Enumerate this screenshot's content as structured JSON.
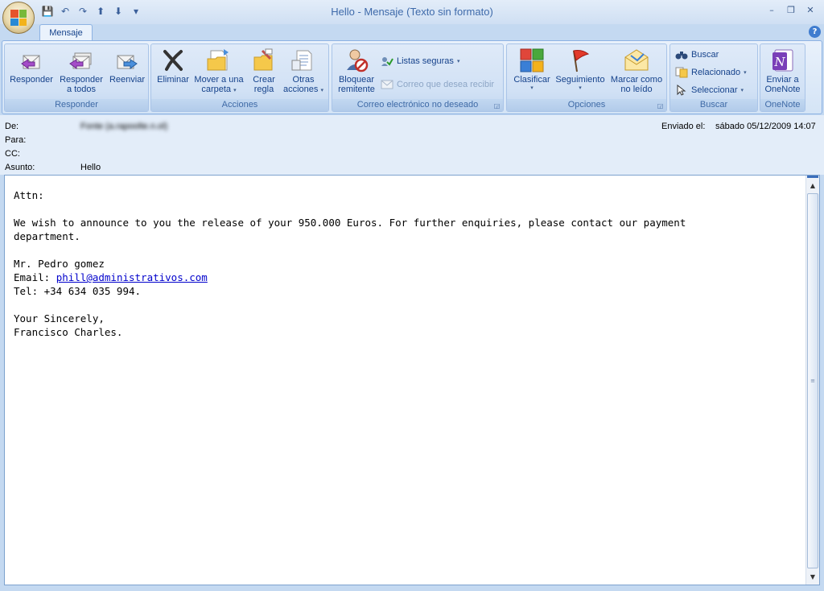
{
  "window": {
    "title": "Hello  -  Mensaje (Texto sin formato)",
    "controls": [
      "–",
      "❐",
      "✕"
    ]
  },
  "qat": [
    "💾",
    "↶",
    "↷",
    "⬆",
    "⬇",
    "▾"
  ],
  "tabs": [
    {
      "label": "Mensaje"
    }
  ],
  "ribbon": {
    "groups": [
      {
        "label": "Responder",
        "buttons": [
          {
            "label": "Responder"
          },
          {
            "label": "Responder\na todos"
          },
          {
            "label": "Reenviar"
          }
        ]
      },
      {
        "label": "Acciones",
        "buttons": [
          {
            "label": "Eliminar"
          },
          {
            "label": "Mover a una\ncarpeta"
          },
          {
            "label": "Crear\nregla"
          },
          {
            "label": "Otras\nacciones"
          }
        ]
      },
      {
        "label": "Correo electrónico no deseado",
        "buttons": [
          {
            "label": "Bloquear\nremitente"
          },
          {
            "label": "Listas seguras"
          },
          {
            "label": "Correo que desea recibir"
          }
        ]
      },
      {
        "label": "Opciones",
        "buttons": [
          {
            "label": "Clasificar"
          },
          {
            "label": "Seguimiento"
          },
          {
            "label": "Marcar como\nno leído"
          }
        ]
      },
      {
        "label": "Buscar",
        "buttons": [
          {
            "label": "Buscar"
          },
          {
            "label": "Relacionado"
          },
          {
            "label": "Seleccionar"
          }
        ]
      },
      {
        "label": "OneNote",
        "buttons": [
          {
            "label": "Enviar a\nOneNote"
          }
        ]
      }
    ]
  },
  "header": {
    "from_label": "De:",
    "from_value": "Fonte (a.rapoolte.n.ol)",
    "to_label": "Para:",
    "cc_label": "CC:",
    "subject_label": "Asunto:",
    "subject_value": "Hello",
    "sent_label": "Enviado el:",
    "sent_value": "sábado 05/12/2009 14:07"
  },
  "body": {
    "line1": "Attn:",
    "line2": "We wish to announce to you the release of your 950.000 Euros. For further enquiries, please contact our payment",
    "line3": "department.",
    "line4": "Mr. Pedro gomez",
    "email_prefix": "Email: ",
    "email_link": "phill@administrativos.com",
    "line6": "Tel: +34 634 035 994.",
    "line7": "Your Sincerely,",
    "line8": "Francisco Charles."
  }
}
